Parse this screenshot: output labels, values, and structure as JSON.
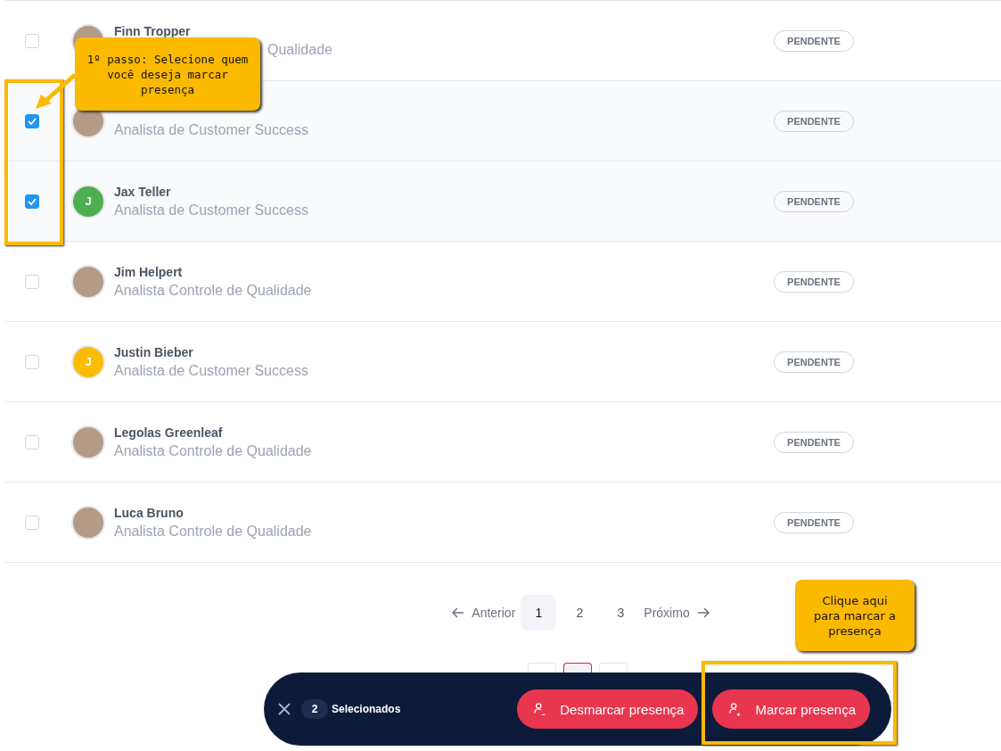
{
  "rows": [
    {
      "kind": "photo",
      "name": "Finn Tropper",
      "subtitle": "Qualidade",
      "subtitle_covered": true,
      "checked": false,
      "status": "PENDENTE"
    },
    {
      "kind": "photo",
      "subtitle": "Analista de Customer Success",
      "checked": true,
      "status": "PENDENTE"
    },
    {
      "kind": "letter",
      "initial": "J",
      "color": "#4caf50",
      "name": "Jax Teller",
      "subtitle": "Analista de Customer Success",
      "checked": true,
      "status": "PENDENTE"
    },
    {
      "kind": "photo",
      "name": "Jim Helpert",
      "subtitle": "Analista Controle de Qualidade",
      "checked": false,
      "status": "PENDENTE"
    },
    {
      "kind": "letter",
      "initial": "J",
      "color": "#fbbc05",
      "name": "Justin Bieber",
      "subtitle": "Analista de Customer Success",
      "checked": false,
      "status": "PENDENTE"
    },
    {
      "kind": "photo",
      "name": "Legolas Greenleaf",
      "subtitle": "Analista Controle de Qualidade",
      "checked": false,
      "status": "PENDENTE"
    },
    {
      "kind": "photo",
      "name": "Luca Bruno",
      "subtitle": "Analista Controle de Qualidade",
      "checked": false,
      "status": "PENDENTE"
    }
  ],
  "pagination": {
    "previous": "Anterior",
    "next": "Próximo",
    "pages": [
      {
        "label": "1",
        "selected": true
      },
      {
        "label": "2",
        "selected": false
      },
      {
        "label": "3",
        "selected": false
      }
    ]
  },
  "action_bar": {
    "count": "2",
    "count_label": "Selecionados",
    "buttons": [
      {
        "label": "Desmarcar presença",
        "kind": "remove"
      },
      {
        "label": "Marcar presença",
        "kind": "add"
      }
    ]
  },
  "callouts": [
    {
      "text": "1º passo: Selecione quem você deseja marcar presença"
    },
    {
      "text": "Clique aqui para marcar a presença"
    }
  ]
}
